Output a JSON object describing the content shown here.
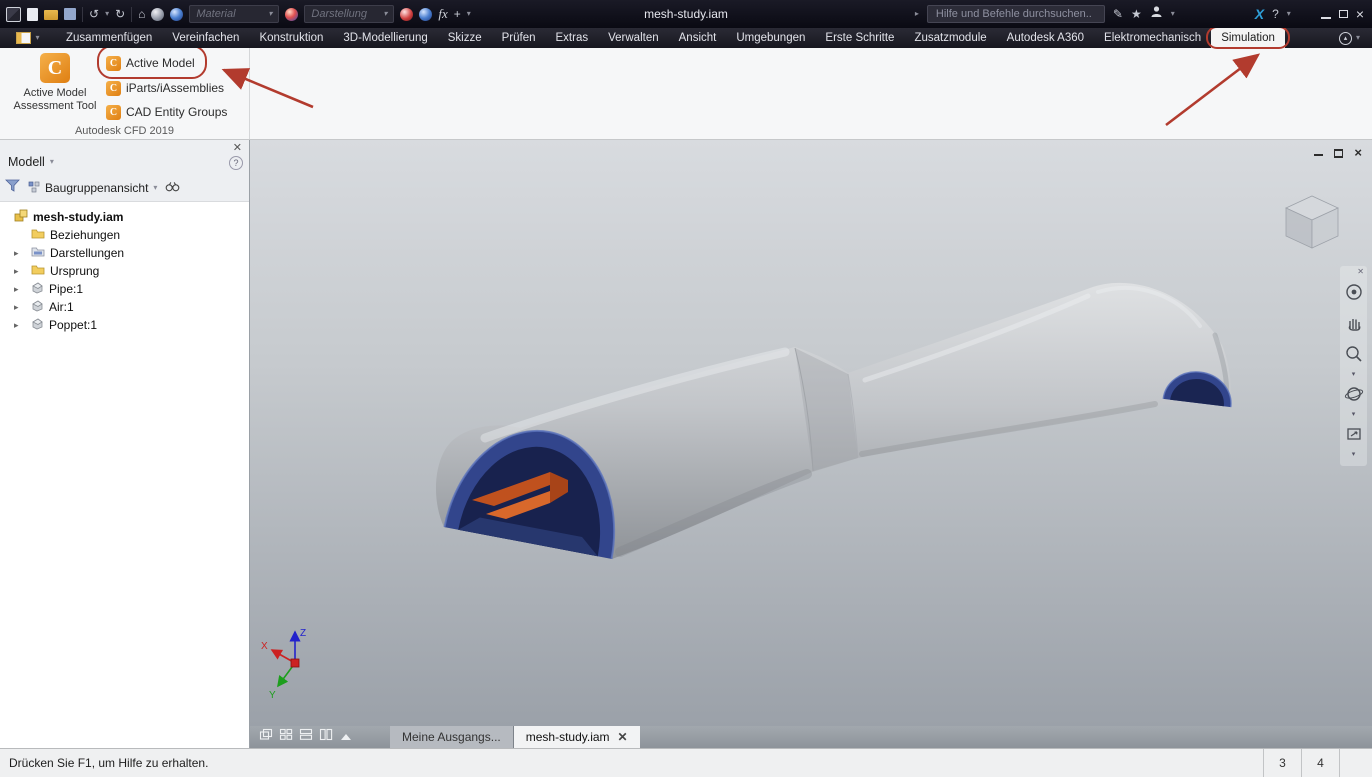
{
  "titlebar": {
    "title": "mesh-study.iam",
    "material_value": "Material",
    "appearance_value": "Darstellung",
    "search_placeholder": "Hilfe und Befehle durchsuchen..",
    "fx_label": "fx",
    "help_label": "?"
  },
  "ribbon": {
    "tabs": [
      "Zusammenfügen",
      "Vereinfachen",
      "Konstruktion",
      "3D-Modellierung",
      "Skizze",
      "Prüfen",
      "Extras",
      "Verwalten",
      "Ansicht",
      "Umgebungen",
      "Erste Schritte",
      "Zusatzmodule",
      "Autodesk A360",
      "Elektromechanisch",
      "Simulation"
    ],
    "active_tab": "Simulation",
    "cfd_panel": {
      "big_button_line1": "Active Model",
      "big_button_line2": "Assessment Tool",
      "buttons": [
        "Active Model",
        "iParts/iAssemblies",
        "CAD Entity Groups"
      ],
      "panel_title": "Autodesk CFD 2019"
    }
  },
  "browser": {
    "title": "Modell",
    "view_mode": "Baugruppenansicht",
    "tree": [
      {
        "label": "mesh-study.iam"
      },
      {
        "label": "Beziehungen"
      },
      {
        "label": "Darstellungen"
      },
      {
        "label": "Ursprung"
      },
      {
        "label": "Pipe:1"
      },
      {
        "label": "Air:1"
      },
      {
        "label": "Poppet:1"
      }
    ]
  },
  "viewport": {
    "doc_tabs": [
      "Meine Ausgangs...",
      "mesh-study.iam"
    ],
    "triad": {
      "x": "X",
      "y": "Y",
      "z": "Z"
    }
  },
  "statusbar": {
    "message": "Drücken Sie F1, um Hilfe zu erhalten.",
    "cell_1": "3",
    "cell_2": "4"
  }
}
